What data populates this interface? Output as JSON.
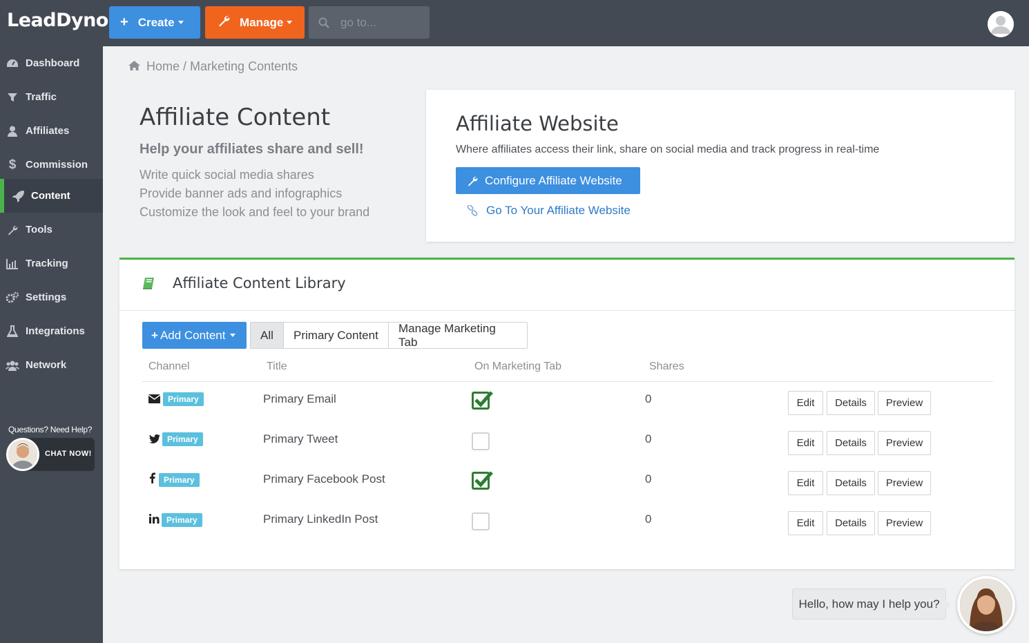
{
  "app": {
    "logo": "LeadDyno"
  },
  "topbar": {
    "create_label": "Create",
    "manage_label": "Manage",
    "search_placeholder": "go to..."
  },
  "sidebar": {
    "items": [
      {
        "label": "Dashboard",
        "icon": "dashboard-icon"
      },
      {
        "label": "Traffic",
        "icon": "filter-icon"
      },
      {
        "label": "Affiliates",
        "icon": "user-icon"
      },
      {
        "label": "Commission",
        "icon": "dollar-icon"
      },
      {
        "label": "Content",
        "icon": "rocket-icon",
        "active": true
      },
      {
        "label": "Tools",
        "icon": "wrench-icon"
      },
      {
        "label": "Tracking",
        "icon": "bar-chart-icon"
      },
      {
        "label": "Settings",
        "icon": "gears-icon"
      },
      {
        "label": "Integrations",
        "icon": "flask-icon"
      },
      {
        "label": "Network",
        "icon": "users-icon"
      }
    ],
    "help_text": "Questions? Need Help?",
    "chat_label": "CHAT NOW!"
  },
  "breadcrumb": {
    "home": "Home",
    "separator": "/",
    "current": "Marketing Contents"
  },
  "intro": {
    "title": "Affiliate Content",
    "subtitle": "Help your affiliates share and sell!",
    "lines": [
      "Write quick social media shares",
      "Provide banner ads and infographics",
      "Customize the look and feel to your brand"
    ]
  },
  "website_card": {
    "title": "Affiliate Website",
    "description": "Where affiliates access their link, share on social media and track progress in real-time",
    "configure_label": "Configure Affiliate Website",
    "goto_label": "Go To Your Affiliate Website"
  },
  "library": {
    "title": "Affiliate Content Library",
    "add_label": "Add Content",
    "filters": [
      "All",
      "Primary Content",
      "Manage Marketing Tab"
    ],
    "columns": [
      "Channel",
      "Title",
      "On Marketing Tab",
      "Shares"
    ],
    "rows": [
      {
        "channel_icon": "envelope-icon",
        "badge": "Primary",
        "title": "Primary Email",
        "on_tab": true,
        "shares": "0"
      },
      {
        "channel_icon": "twitter-icon",
        "badge": "Primary",
        "title": "Primary Tweet",
        "on_tab": false,
        "shares": "0"
      },
      {
        "channel_icon": "facebook-icon",
        "badge": "Primary",
        "title": "Primary Facebook Post",
        "on_tab": true,
        "shares": "0"
      },
      {
        "channel_icon": "linkedin-icon",
        "badge": "Primary",
        "title": "Primary LinkedIn Post",
        "on_tab": false,
        "shares": "0"
      }
    ],
    "actions": [
      "Edit",
      "Details",
      "Preview"
    ]
  },
  "chat": {
    "bubble": "Hello, how may I help you?"
  },
  "colors": {
    "primary": "#3d8fe0",
    "manage": "#f0641e",
    "active": "#4ab34a",
    "badge": "#5bc0de",
    "sidebar": "#434a54"
  }
}
